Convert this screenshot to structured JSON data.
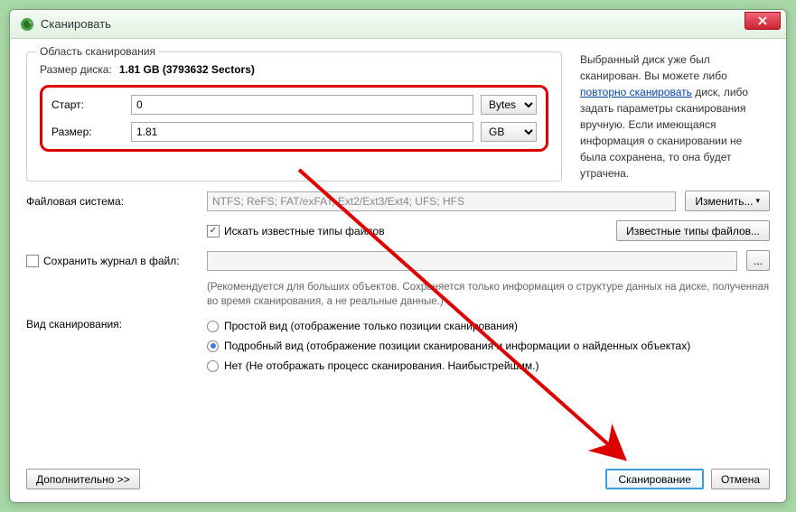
{
  "window": {
    "title": "Сканировать"
  },
  "groupbox": {
    "title": "Область сканирования"
  },
  "disk_size": {
    "label": "Размер диска:",
    "value": "1.81 GB (3793632 Sectors)"
  },
  "start": {
    "label": "Старт:",
    "value": "0",
    "unit": "Bytes"
  },
  "size": {
    "label": "Размер:",
    "value": "1.81",
    "unit": "GB"
  },
  "info_prefix": "Выбранный диск уже был сканирован. Вы можете либо ",
  "info_link": "повторно сканировать",
  "info_suffix": " диск, либо задать параметры сканирования вручную. Если имеющаяся информация о сканировании не была сохранена, то она будет утрачена.",
  "fs": {
    "label": "Файловая система:",
    "value": "NTFS; ReFS; FAT/exFAT; Ext2/Ext3/Ext4; UFS; HFS"
  },
  "change_btn": "Изменить...",
  "known_types_cb": "Искать известные типы файлов",
  "known_types_btn": "Известные типы файлов...",
  "save_log": {
    "label": "Сохранить журнал в файл:"
  },
  "hint": "(Рекомендуется для больших объектов. Сохраняется только информация о структуре данных на диске, полученная во время сканирования, а не реальные данные.)",
  "scan_view": {
    "label": "Вид сканирования:"
  },
  "radio_simple": "Простой вид (отображение только позиции сканирования)",
  "radio_detailed": "Подробный вид (отображение позиции сканирования и информации о найденных объектах)",
  "radio_none": "Нет (Не отображать процесс сканирования. Наибыстрейшим.)",
  "advanced_btn": "Дополнительно >>",
  "scan_btn": "Сканирование",
  "cancel_btn": "Отмена"
}
